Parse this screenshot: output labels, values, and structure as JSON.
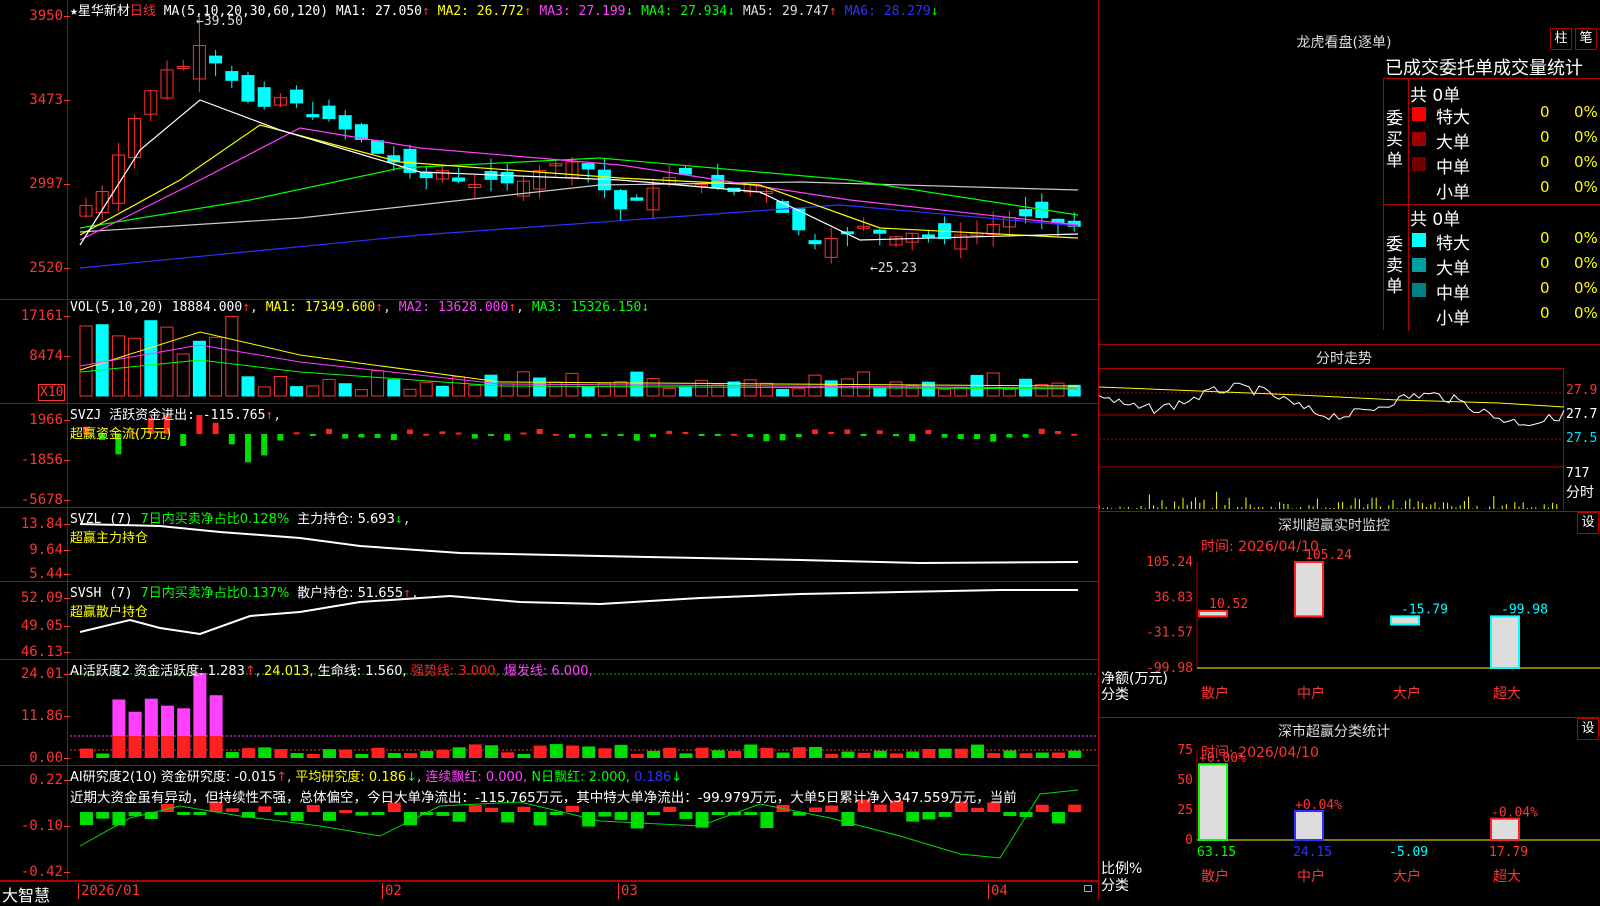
{
  "app": {
    "brand": "大智慧"
  },
  "stock": {
    "star": "★",
    "name": "星华新材",
    "period": "日线"
  },
  "main_chart": {
    "ma_header": "MA(5,10,20,30,60,120)",
    "ma": [
      {
        "label": "MA1:",
        "value": "27.050",
        "dir": "↑",
        "color": "#ffffff"
      },
      {
        "label": "MA2:",
        "value": "26.772",
        "dir": "↑",
        "color": "#ffff00"
      },
      {
        "label": "MA3:",
        "value": "27.199",
        "dir": "↓",
        "color": "#ff40ff"
      },
      {
        "label": "MA4:",
        "value": "27.934",
        "dir": "↓",
        "color": "#00ff00"
      },
      {
        "label": "MA5:",
        "value": "29.747",
        "dir": "↑",
        "color": "#dddddd"
      },
      {
        "label": "MA6:",
        "value": "28.279",
        "dir": "↓",
        "color": "#3030ff"
      }
    ],
    "y_ticks": [
      "3950",
      "3473",
      "2997",
      "2520"
    ],
    "high_label": "39.50",
    "low_label": "25.23"
  },
  "vol_panel": {
    "header": "VOL(5,10,20)",
    "value": "18884.000",
    "ma1": "MA1: 17349.600",
    "ma2": "MA2: 13628.000",
    "ma3": "MA3: 15326.150",
    "y_ticks": [
      "17161",
      "8474"
    ],
    "unit": "X10"
  },
  "svzj_panel": {
    "header": "SVZJ  活跃资金进出: -115.765",
    "sub": "超赢资金流(万元)",
    "y_ticks": [
      "1966",
      "-1856",
      "-5678"
    ]
  },
  "svzl_panel": {
    "header": "SVZL (7)",
    "ratio": "7日内买卖净占比0.128%",
    "pos": "主力持仓: 5.693",
    "sub": "超赢主力持仓",
    "y_ticks": [
      "13.84",
      "9.64",
      "5.44"
    ]
  },
  "svsh_panel": {
    "header": "SVSH (7)",
    "ratio": "7日内买卖净占比0.137%",
    "pos": "散户持仓: 51.655",
    "sub": "超赢散户持仓",
    "y_ticks": [
      "52.09",
      "49.05",
      "46.13"
    ]
  },
  "ai_active": {
    "header": "AI活跃度2 资金活跃度: 1.283",
    "v2": "24.013",
    "v3": "生命线: 1.560,",
    "v4": "强势线: 3.000,",
    "v5": "爆发线: 6.000,",
    "y_ticks": [
      "24.01",
      "11.86",
      "0.00"
    ]
  },
  "ai_research": {
    "header": "AI研究度2(10) 资金研究度: -0.015",
    "avg": "平均研究度: 0.186",
    "lianxu": "连续飘红: 0.000,",
    "nday": "N日飘红: 2.000,",
    "last": "0.186",
    "comment": "近期大资金虽有异动，但持续性不强，总体偏空，今日大单净流出：-115.765万元，其中特大单净流出：-99.979万元，大单5日累计净入347.559万元，当前",
    "y_ticks": [
      "0.22",
      "-0.10",
      "-0.42"
    ]
  },
  "x_axis": {
    "labels": [
      "2026/01",
      "02",
      "03",
      "04"
    ]
  },
  "longhu": {
    "title": "龙虎看盘(逐单)",
    "btn_bar": "柱",
    "btn_pen": "笔",
    "subtitle": "已成交委托单成交量统计",
    "buy_label": "委买单",
    "sell_label": "委卖单",
    "buy_total": "共 0单",
    "sell_total": "共 0单",
    "buy_rows": [
      {
        "name": "特大",
        "count": "0",
        "pct": "0%",
        "color": "#ff0000"
      },
      {
        "name": "大单",
        "count": "0",
        "pct": "0%",
        "color": "#a00000"
      },
      {
        "name": "中单",
        "count": "0",
        "pct": "0%",
        "color": "#700000"
      },
      {
        "name": "小单",
        "count": "0",
        "pct": "0%",
        "color": ""
      }
    ],
    "sell_rows": [
      {
        "name": "特大",
        "count": "0",
        "pct": "0%",
        "color": "#00ffff"
      },
      {
        "name": "大单",
        "count": "0",
        "pct": "0%",
        "color": "#00a0a0"
      },
      {
        "name": "中单",
        "count": "0",
        "pct": "0%",
        "color": "#008080"
      },
      {
        "name": "小单",
        "count": "0",
        "pct": "0%",
        "color": ""
      }
    ]
  },
  "fenshi": {
    "title": "分时走势",
    "prices": [
      "27.9",
      "27.7",
      "27.5"
    ],
    "vol": "717",
    "btn": "分时"
  },
  "sz_monitor": {
    "title": "深圳超赢实时监控",
    "btn": "设",
    "date": "时间: 2026/04/10",
    "y_ticks": [
      "105.24",
      "36.83",
      "-31.57",
      "-99.98"
    ],
    "ylabel": "净额(万元)",
    "xlabel": "分类",
    "cats": [
      "散户",
      "中户",
      "大户",
      "超大"
    ],
    "values": [
      10.52,
      105.24,
      -15.79,
      -99.98
    ],
    "value_labels": [
      "10.52",
      "105.24",
      "-15.79",
      "-99.98"
    ]
  },
  "sz_stat": {
    "title": "深市超赢分类统计",
    "btn": "设",
    "date": "时间: 2026/04/10",
    "y_ticks": [
      "75",
      "50",
      "25",
      "0"
    ],
    "ylabel": "比例%",
    "xlabel": "分类",
    "cats": [
      "散户",
      "中户",
      "大户",
      "超大"
    ],
    "values": [
      63.15,
      24.15,
      -5.09,
      17.79
    ],
    "bottom_labels": [
      "63.15",
      "24.15",
      "-5.09",
      "17.79"
    ],
    "top_labels": [
      "+0.00%",
      "+0.04%",
      "",
      "-0.04%"
    ]
  },
  "chart_data": [
    {
      "type": "bar",
      "title": "深圳超赢实时监控",
      "categories": [
        "散户",
        "中户",
        "大户",
        "超大"
      ],
      "values": [
        10.52,
        105.24,
        -15.79,
        -99.98
      ],
      "ylabel": "净额(万元)",
      "ylim": [
        -99.98,
        105.24
      ]
    },
    {
      "type": "bar",
      "title": "深市超赢分类统计",
      "categories": [
        "散户",
        "中户",
        "大户",
        "超大"
      ],
      "values": [
        63.15,
        24.15,
        -5.09,
        17.79
      ],
      "ylabel": "比例%",
      "ylim": [
        0,
        75
      ]
    }
  ]
}
